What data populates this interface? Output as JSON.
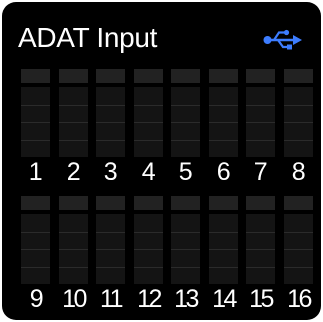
{
  "panel": {
    "title": "ADAT Input",
    "usb_icon": "usb-icon",
    "accent_color": "#3d7dff"
  },
  "channels": [
    {
      "label": "1",
      "level": 0
    },
    {
      "label": "2",
      "level": 0
    },
    {
      "label": "3",
      "level": 0
    },
    {
      "label": "4",
      "level": 0
    },
    {
      "label": "5",
      "level": 0
    },
    {
      "label": "6",
      "level": 0
    },
    {
      "label": "7",
      "level": 0
    },
    {
      "label": "8",
      "level": 0
    },
    {
      "label": "9",
      "level": 0
    },
    {
      "label": "10",
      "level": 0
    },
    {
      "label": "11",
      "level": 0
    },
    {
      "label": "12",
      "level": 0
    },
    {
      "label": "13",
      "level": 0
    },
    {
      "label": "14",
      "level": 0
    },
    {
      "label": "15",
      "level": 0
    },
    {
      "label": "16",
      "level": 0
    }
  ]
}
